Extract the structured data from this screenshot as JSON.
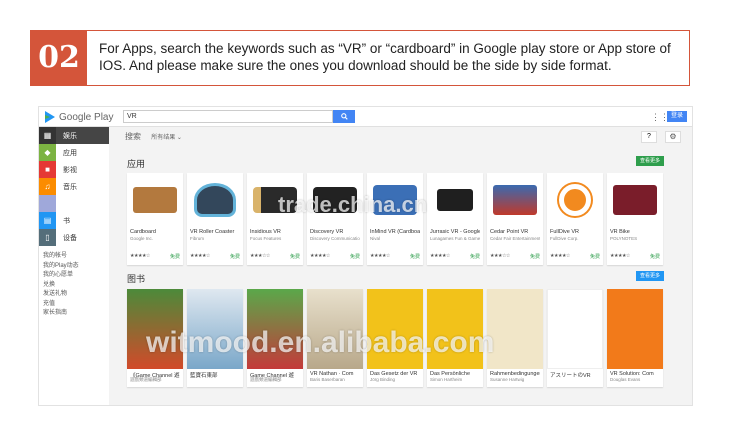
{
  "banner": {
    "number": "02",
    "text": "For Apps, search the keywords such as “VR” or “cardboard” in Google play store or App store of IOS. And please make sure the ones you download should be the side by side format."
  },
  "store": {
    "logo": "Google Play",
    "search_value": "VR",
    "search_button_icon": "search-icon",
    "signin_label": "登录",
    "sidebar": {
      "categories": [
        {
          "label": "娱乐",
          "icon": "entertainment-icon",
          "color": "#454545"
        },
        {
          "label": "应用",
          "icon": "android-icon",
          "color": "#7cb342"
        },
        {
          "label": "影视",
          "icon": "film-icon",
          "color": "#e53935"
        },
        {
          "label": "音乐",
          "icon": "music-icon",
          "color": "#fb8c00"
        },
        {
          "label": "",
          "icon": "",
          "color": "#9fa8da"
        },
        {
          "label": "书",
          "icon": "book-icon",
          "color": "#2196f3"
        },
        {
          "label": "设备",
          "icon": "device-icon",
          "color": "#546e7a"
        }
      ],
      "links": [
        "我的帐号",
        "我的Play动态",
        "我的心愿单",
        "兑换",
        "发送礼物",
        "充值",
        "家长指南"
      ]
    },
    "subbar": {
      "title": "搜索",
      "filter": "所有结果 ⌄"
    },
    "apps_section": {
      "title": "应用",
      "more": "查看更多",
      "items": [
        {
          "title": "Cardboard",
          "sub": "Google Inc.",
          "price": "免费"
        },
        {
          "title": "VR Roller Coaster",
          "sub": "Fibrum",
          "price": "免费"
        },
        {
          "title": "Insidious VR",
          "sub": "Focus Features",
          "price": "免费"
        },
        {
          "title": "Discovery VR",
          "sub": "Discovery Communications",
          "price": "免费"
        },
        {
          "title": "InMind VR (Cardboard)",
          "sub": "Nival",
          "price": "免费"
        },
        {
          "title": "Jurrasic VR - Google",
          "sub": "Lunagames Fun & Games",
          "price": "免费"
        },
        {
          "title": "Cedar Point VR",
          "sub": "Cedar Fair Entertainment",
          "price": "免费"
        },
        {
          "title": "FullDive VR",
          "sub": "FullDive Corp.",
          "price": "免费"
        },
        {
          "title": "VR Bike",
          "sub": "POLYNOTES",
          "price": "免费"
        }
      ]
    },
    "books_section": {
      "title": "图书",
      "more": "查看更多",
      "items": [
        {
          "title": "《Game Channel 遊",
          "sub": "遊戲頻道編輯部",
          "price": "US$1.46"
        },
        {
          "title": "藍寶石東部",
          "sub": "",
          "price": "US$2.02"
        },
        {
          "title": "Game Channel 遊",
          "sub": "遊戲頻道編輯部",
          "price": "US$1.46"
        },
        {
          "title": "VR Nathan · Com",
          "sub": "Baris Baserbaran",
          "price": "US$12.00"
        },
        {
          "title": "Das Gesetz der VR",
          "sub": "Jörg Binding",
          "price": "US$134.60"
        },
        {
          "title": "Das Persönliche",
          "sub": "Simon Hartheim",
          "price": "US$28.99"
        },
        {
          "title": "Rahmenbedingungen",
          "sub": "Susanne Hartwig",
          "price": "US$29.21"
        },
        {
          "title": "アスリートのVR",
          "sub": "",
          "price": "US$5.29"
        },
        {
          "title": "VR Solution: Com",
          "sub": "Douglas Evans",
          "price": "US$2.00"
        }
      ]
    }
  },
  "watermarks": [
    "trade.china.cn",
    "witmood.en.alibaba.com"
  ],
  "colors": {
    "banner_accent": "#d4553a",
    "play_green": "#2e9e4c",
    "search_blue": "#4285f4",
    "more_green": "#2e9e4c",
    "more_blue": "#2196f3"
  }
}
